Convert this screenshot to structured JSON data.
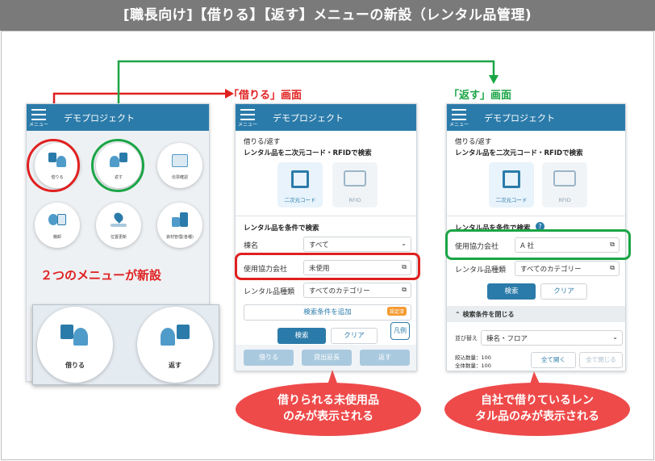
{
  "banner": "[職長向け]【借りる】【返す】メニューの新設（レンタル品管理)",
  "app_title": "デモプロジェクト",
  "menu_label": "メニュー",
  "left_phone": {
    "menu_items": [
      "借りる",
      "返す",
      "伝票確認",
      "棚卸",
      "位置更新",
      "資材管理(各種)"
    ],
    "callout": "２つのメニューが新設",
    "zoom": {
      "borrow": "借りる",
      "return": "返す"
    }
  },
  "borrow_screen": {
    "caption": "「借りる」画面",
    "breadcrumb": "借りる/返す",
    "search_title": "レンタル品を二次元コード・RFIDで検索",
    "qr_label": "二次元コード",
    "rfid_label": "RFID",
    "cond_title": "レンタル品を条件で検索",
    "rows": [
      {
        "label": "棟名",
        "value": "すべて",
        "ctrl": "chevron"
      },
      {
        "label": "使用協力会社",
        "value": "未使用",
        "ctrl": "copy"
      },
      {
        "label": "レンタル品種類",
        "value": "すべてのカテゴリー",
        "ctrl": "copy"
      }
    ],
    "add_cond": "検索条件を追加",
    "badge_set": "設定済",
    "legend": "凡例",
    "search": "検索",
    "clear": "クリア",
    "bottom": [
      "借りる",
      "貸出延長",
      "返す"
    ],
    "bubble": "借りられる未使用品\nのみが表示される"
  },
  "return_screen": {
    "caption": "「返す」画面",
    "breadcrumb": "借りる/返す",
    "search_title": "レンタル品を二次元コード・RFIDで検索",
    "qr_label": "二次元コード",
    "rfid_label": "RFID",
    "cond_title": "レンタル品を条件で検索",
    "help": "?",
    "rows": [
      {
        "label": "使用協力会社",
        "value": "A 社",
        "ctrl": "copy"
      },
      {
        "label": "レンタル品種類",
        "value": "すべてのカテゴリー",
        "ctrl": "copy"
      }
    ],
    "search": "検索",
    "clear": "クリア",
    "collapse": "検索条件を閉じる",
    "sort_label": "並び替え",
    "sort_value": "棟名・フロア",
    "count1": "絞込数量：100",
    "count2": "全体数量：100",
    "expand_all": "全て開く",
    "close_all": "全て閉じる",
    "bubble": "自社で借りているレン\nタル品のみが表示される"
  },
  "colors": {
    "red": "#e02020",
    "green": "#1aa545",
    "blue": "#2b7baa"
  }
}
